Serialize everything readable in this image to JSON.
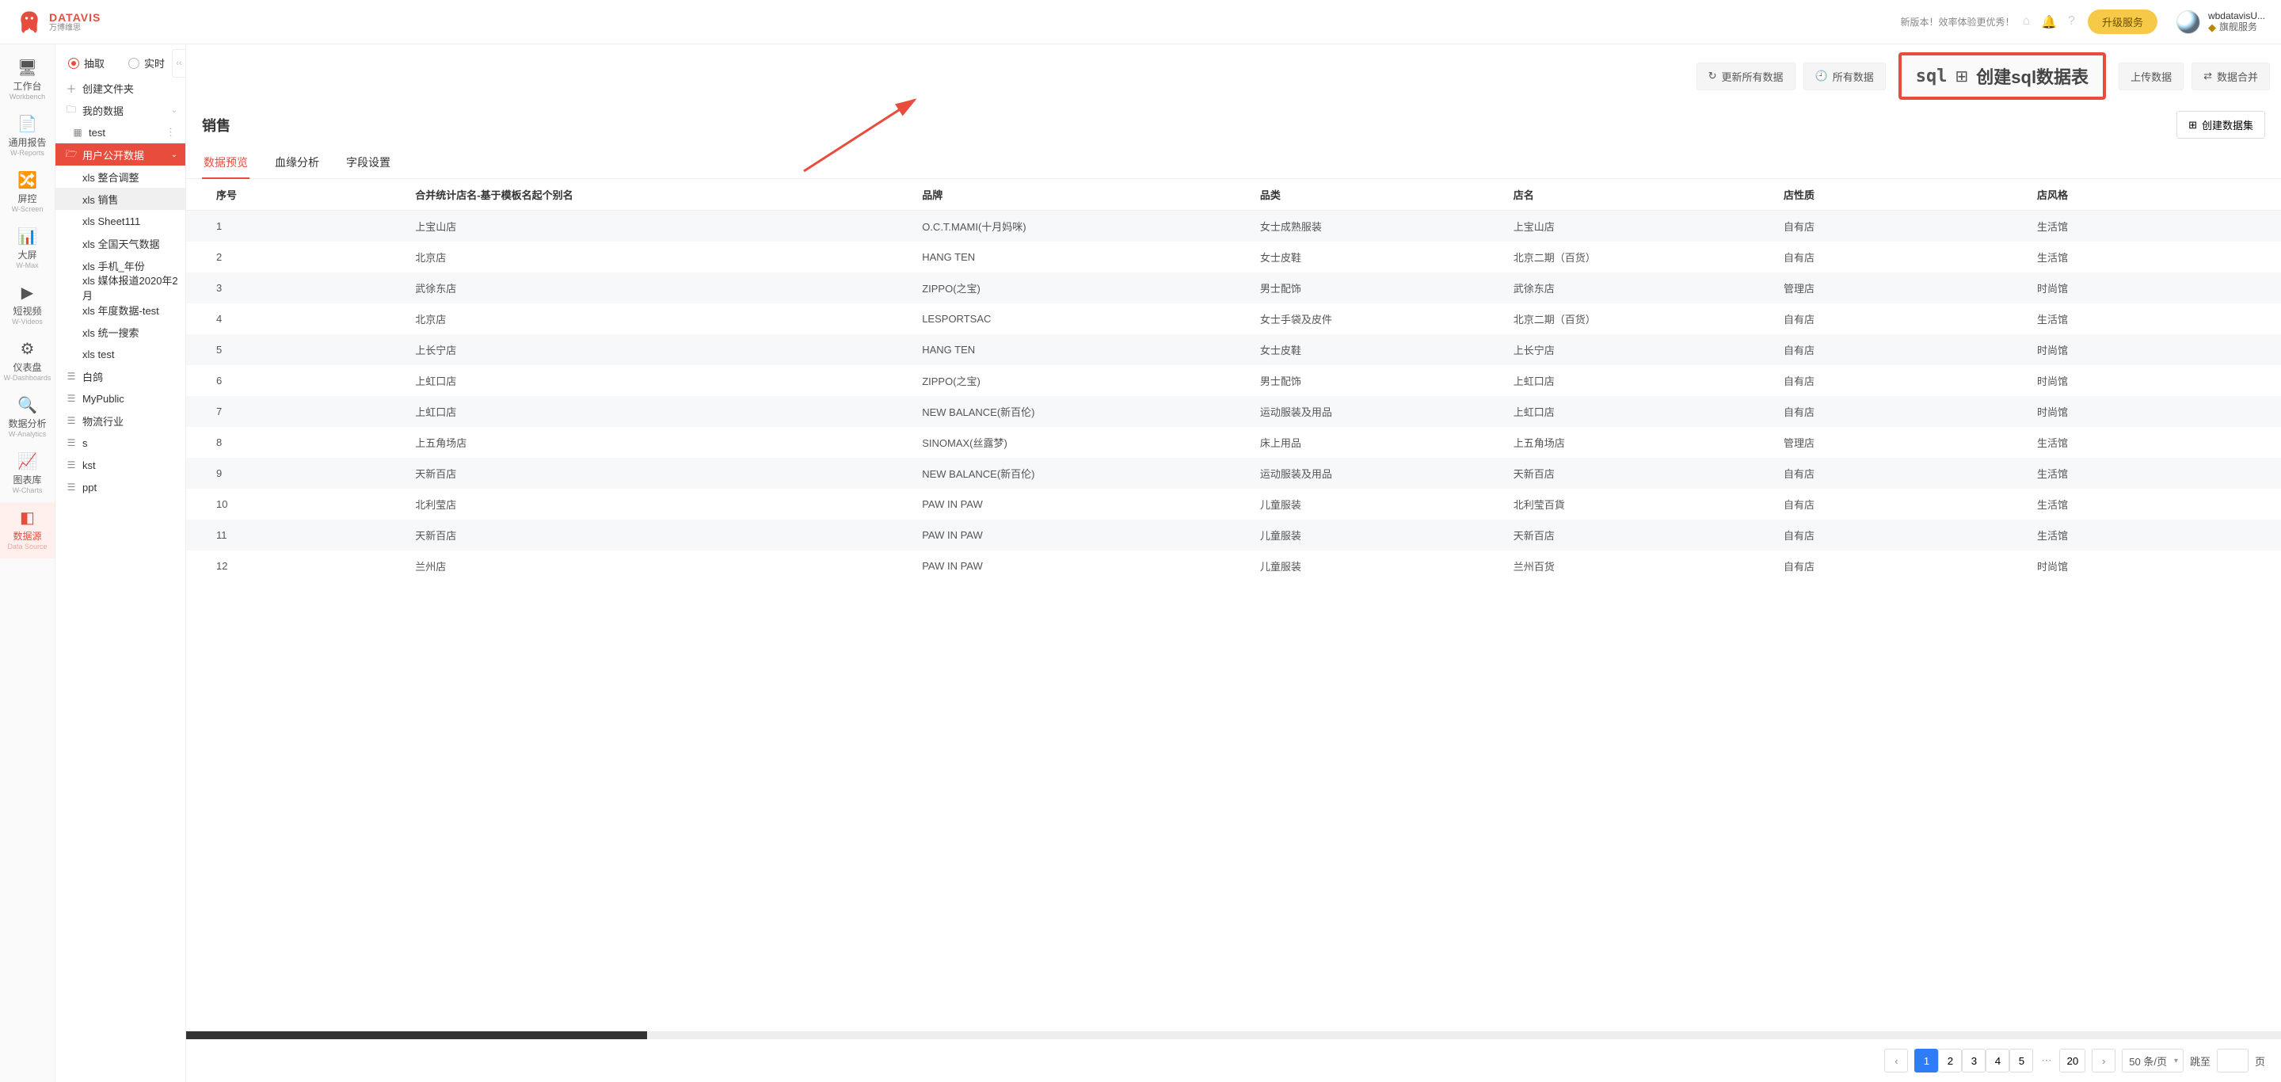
{
  "brand": {
    "en": "DATAVIS",
    "cn": "万博维思"
  },
  "topbar": {
    "notice": "新版本！效率体验更优秀！",
    "upgrade": "升级服务",
    "username": "wbdatavisU...",
    "plan": "旗舰服务"
  },
  "rail": [
    {
      "cn": "工作台",
      "en": "Workbench",
      "icon": "🖥"
    },
    {
      "cn": "通用报告",
      "en": "W-Reports",
      "icon": "📄"
    },
    {
      "cn": "屏控",
      "en": "W-Screen",
      "icon": "🔀"
    },
    {
      "cn": "大屏",
      "en": "W-Max",
      "icon": "📊"
    },
    {
      "cn": "短视频",
      "en": "W-Videos",
      "icon": "▶"
    },
    {
      "cn": "仪表盘",
      "en": "W-Dashboards",
      "icon": "⚙"
    },
    {
      "cn": "数据分析",
      "en": "W-Analytics",
      "icon": "🔍"
    },
    {
      "cn": "图表库",
      "en": "W-Charts",
      "icon": "📈"
    },
    {
      "cn": "数据源",
      "en": "Data Source",
      "icon": "◧",
      "active": true
    }
  ],
  "mode": {
    "extract": "抽取",
    "realtime": "实时"
  },
  "tree": {
    "create_folder": "创建文件夹",
    "my_data": "我的数据",
    "test_item": "test",
    "public_folder": "用户公开数据",
    "public_children": [
      "xls 整合调整",
      "xls 销售",
      "xls Sheet111",
      "xls 全国天气数据",
      "xls 手机_年份",
      "xls 媒体报道2020年2月",
      "xls 年度数据-test",
      "xls 统一搜索",
      "xls test"
    ],
    "other_items": [
      "白鸽",
      "MyPublic",
      "物流行业",
      "s",
      "kst",
      "ppt"
    ]
  },
  "toolbar": {
    "refresh_all": "更新所有数据",
    "all_data": "所有数据",
    "upload": "上传数据",
    "merge": "数据合并"
  },
  "callout": {
    "sql": "sql",
    "label": "创建sql数据表"
  },
  "page": {
    "title": "销售",
    "create_dataset": "创建数据集"
  },
  "tabs": {
    "preview": "数据预览",
    "lineage": "血缘分析",
    "fields": "字段设置"
  },
  "table": {
    "columns": [
      "序号",
      "合并统计店名-基于模板名起个别名",
      "品牌",
      "品类",
      "店名",
      "店性质",
      "店风格"
    ],
    "rows": [
      [
        "1",
        "上宝山店",
        "O.C.T.MAMI(十月妈咪)",
        "女士成熟服装",
        "上宝山店",
        "自有店",
        "生活馆"
      ],
      [
        "2",
        "北京店",
        "HANG TEN",
        "女士皮鞋",
        "北京二期（百货）",
        "自有店",
        "生活馆"
      ],
      [
        "3",
        "武徐东店",
        "ZIPPO(之宝)",
        "男士配饰",
        "武徐东店",
        "管理店",
        "时尚馆"
      ],
      [
        "4",
        "北京店",
        "LESPORTSAC",
        "女士手袋及皮件",
        "北京二期（百货）",
        "自有店",
        "生活馆"
      ],
      [
        "5",
        "上长宁店",
        "HANG TEN",
        "女士皮鞋",
        "上长宁店",
        "自有店",
        "时尚馆"
      ],
      [
        "6",
        "上虹口店",
        "ZIPPO(之宝)",
        "男士配饰",
        "上虹口店",
        "自有店",
        "时尚馆"
      ],
      [
        "7",
        "上虹口店",
        "NEW BALANCE(新百伦)",
        "运动服装及用品",
        "上虹口店",
        "自有店",
        "时尚馆"
      ],
      [
        "8",
        "上五角场店",
        "SINOMAX(丝露梦)",
        "床上用品",
        "上五角场店",
        "管理店",
        "生活馆"
      ],
      [
        "9",
        "天新百店",
        "NEW BALANCE(新百伦)",
        "运动服装及用品",
        "天新百店",
        "自有店",
        "生活馆"
      ],
      [
        "10",
        "北利莹店",
        "PAW IN PAW",
        "儿童服装",
        "北利莹百貨",
        "自有店",
        "生活馆"
      ],
      [
        "11",
        "天新百店",
        "PAW IN PAW",
        "儿童服装",
        "天新百店",
        "自有店",
        "生活馆"
      ],
      [
        "12",
        "兰州店",
        "PAW IN PAW",
        "儿童服装",
        "兰州百货",
        "自有店",
        "时尚馆"
      ]
    ]
  },
  "pager": {
    "pages": [
      "1",
      "2",
      "3",
      "4",
      "5"
    ],
    "last": "20",
    "size": "50 条/页",
    "jump_label": "跳至",
    "page_suffix": "页"
  }
}
